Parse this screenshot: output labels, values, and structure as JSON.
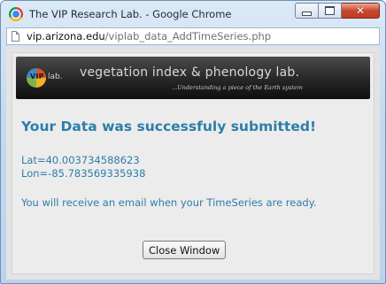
{
  "window": {
    "title": "The VIP Research Lab. - Google Chrome",
    "controls": {
      "minimize_icon": "minimize-icon",
      "maximize_icon": "maximize-icon",
      "close_glyph": "✕"
    }
  },
  "address_bar": {
    "domain": "vip.arizona.edu",
    "path": "/viplab_data_AddTimeSeries.php",
    "page_icon": "page-icon"
  },
  "banner": {
    "logo_text": "VIP",
    "logo_lab": "lab.",
    "title": "vegetation index & phenology lab.",
    "tagline": "...Understanding a piece of the Earth system"
  },
  "content": {
    "heading": "Your Data was successfuly submitted!",
    "lat": "Lat=40.003734588623",
    "lon": "Lon=-85.783569335938",
    "notice": "You will receive an email when your TimeSeries are ready.",
    "close_button": "Close Window"
  },
  "colors": {
    "accent": "#2d7ea8",
    "banner_bg": "#262626",
    "panel_bg": "#ececec",
    "titlebar": "#c5d9ef"
  }
}
